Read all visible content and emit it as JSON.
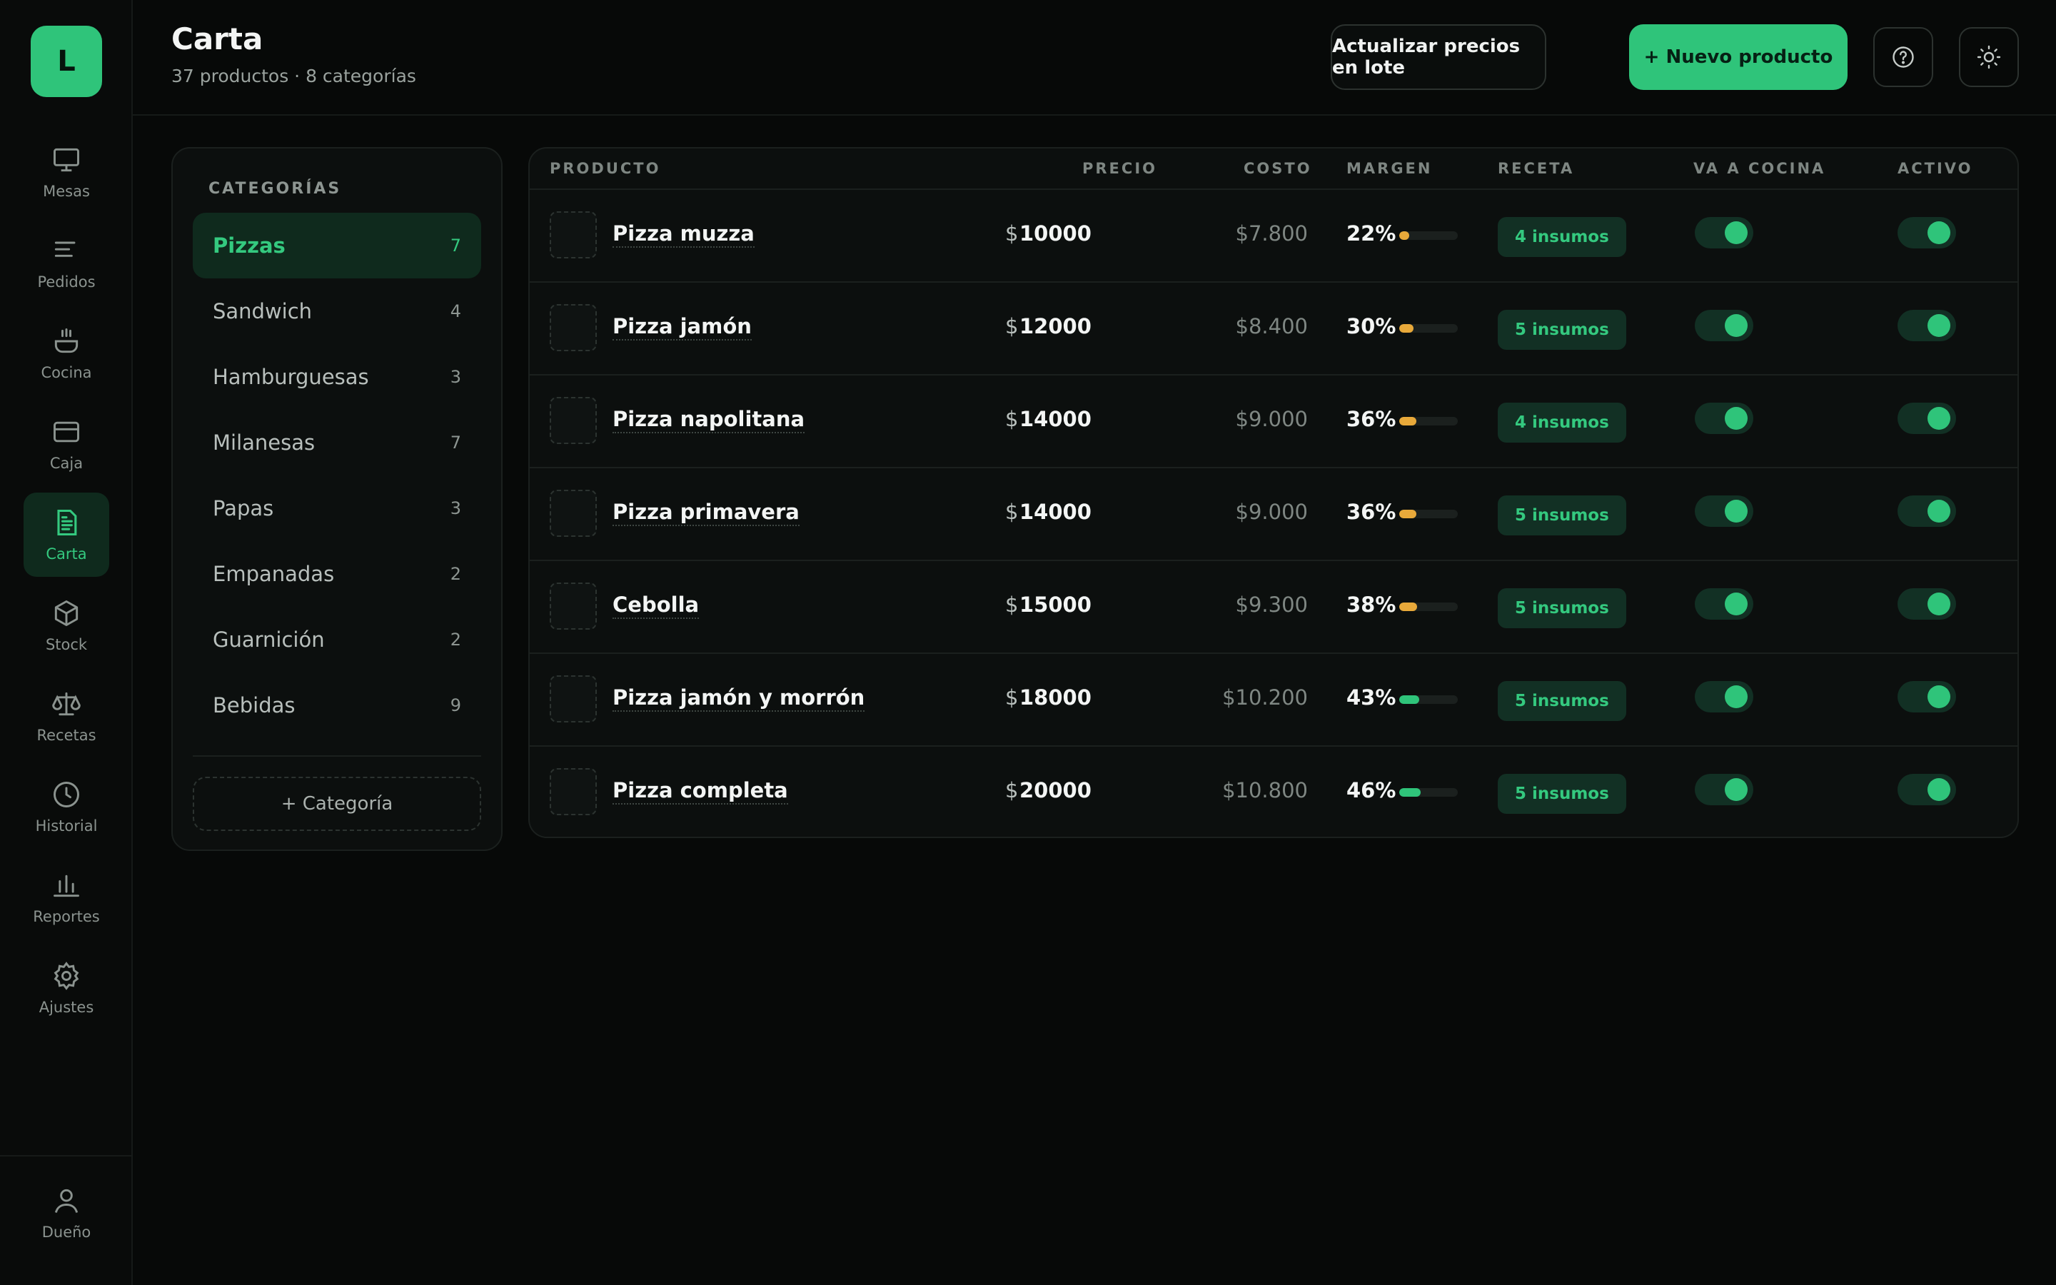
{
  "brand": {
    "logo_letter": "L",
    "accent": "#2fc47a"
  },
  "sidebar": {
    "items": [
      {
        "label": "Mesas",
        "icon": "monitor-icon"
      },
      {
        "label": "Pedidos",
        "icon": "list-icon"
      },
      {
        "label": "Cocina",
        "icon": "cooking-pot-icon"
      },
      {
        "label": "Caja",
        "icon": "credit-card-icon"
      },
      {
        "label": "Carta",
        "icon": "document-icon",
        "active": true
      },
      {
        "label": "Stock",
        "icon": "box-icon"
      },
      {
        "label": "Recetas",
        "icon": "scale-icon"
      },
      {
        "label": "Historial",
        "icon": "clock-icon"
      },
      {
        "label": "Reportes",
        "icon": "bar-chart-icon"
      },
      {
        "label": "Ajustes",
        "icon": "gear-icon"
      }
    ],
    "user": {
      "label": "Dueño",
      "icon": "user-icon"
    }
  },
  "header": {
    "title": "Carta",
    "subtitle": "37 productos · 8 categorías",
    "bulk_update_label": "Actualizar precios en lote",
    "new_product_label": "+ Nuevo producto"
  },
  "categories": {
    "heading": "CATEGORÍAS",
    "items": [
      {
        "name": "Pizzas",
        "count": "7",
        "active": true
      },
      {
        "name": "Sandwich",
        "count": "4"
      },
      {
        "name": "Hamburguesas",
        "count": "3"
      },
      {
        "name": "Milanesas",
        "count": "7"
      },
      {
        "name": "Papas",
        "count": "3"
      },
      {
        "name": "Empanadas",
        "count": "2"
      },
      {
        "name": "Guarnición",
        "count": "2"
      },
      {
        "name": "Bebidas",
        "count": "9"
      }
    ],
    "add_label": "+ Categoría"
  },
  "table": {
    "columns": {
      "product": "PRODUCTO",
      "price": "PRECIO",
      "cost": "COSTO",
      "margin": "MARGEN",
      "recipe": "RECETA",
      "kitchen": "VA A COCINA",
      "active": "ACTIVO"
    },
    "currency": "$",
    "rows": [
      {
        "name": "Pizza muzza",
        "price": "10000",
        "cost": "$7.800",
        "margin": "22%",
        "margin_fraction": 0.22,
        "margin_color": "#e8a93a",
        "recipe": "4 insumos",
        "kitchen": true,
        "active": true
      },
      {
        "name": "Pizza jamón",
        "price": "12000",
        "cost": "$8.400",
        "margin": "30%",
        "margin_fraction": 0.3,
        "margin_color": "#e8a93a",
        "recipe": "5 insumos",
        "kitchen": true,
        "active": true
      },
      {
        "name": "Pizza napolitana",
        "price": "14000",
        "cost": "$9.000",
        "margin": "36%",
        "margin_fraction": 0.36,
        "margin_color": "#e8a93a",
        "recipe": "4 insumos",
        "kitchen": true,
        "active": true
      },
      {
        "name": "Pizza primavera",
        "price": "14000",
        "cost": "$9.000",
        "margin": "36%",
        "margin_fraction": 0.36,
        "margin_color": "#e8a93a",
        "recipe": "5 insumos",
        "kitchen": true,
        "active": true
      },
      {
        "name": "Cebolla",
        "price": "15000",
        "cost": "$9.300",
        "margin": "38%",
        "margin_fraction": 0.38,
        "margin_color": "#e8a93a",
        "recipe": "5 insumos",
        "kitchen": true,
        "active": true
      },
      {
        "name": "Pizza jamón y morrón",
        "price": "18000",
        "cost": "$10.200",
        "margin": "43%",
        "margin_fraction": 0.43,
        "margin_color": "#2fc47a",
        "recipe": "5 insumos",
        "kitchen": true,
        "active": true
      },
      {
        "name": "Pizza completa",
        "price": "20000",
        "cost": "$10.800",
        "margin": "46%",
        "margin_fraction": 0.46,
        "margin_color": "#2fc47a",
        "recipe": "5 insumos",
        "kitchen": true,
        "active": true
      }
    ]
  }
}
